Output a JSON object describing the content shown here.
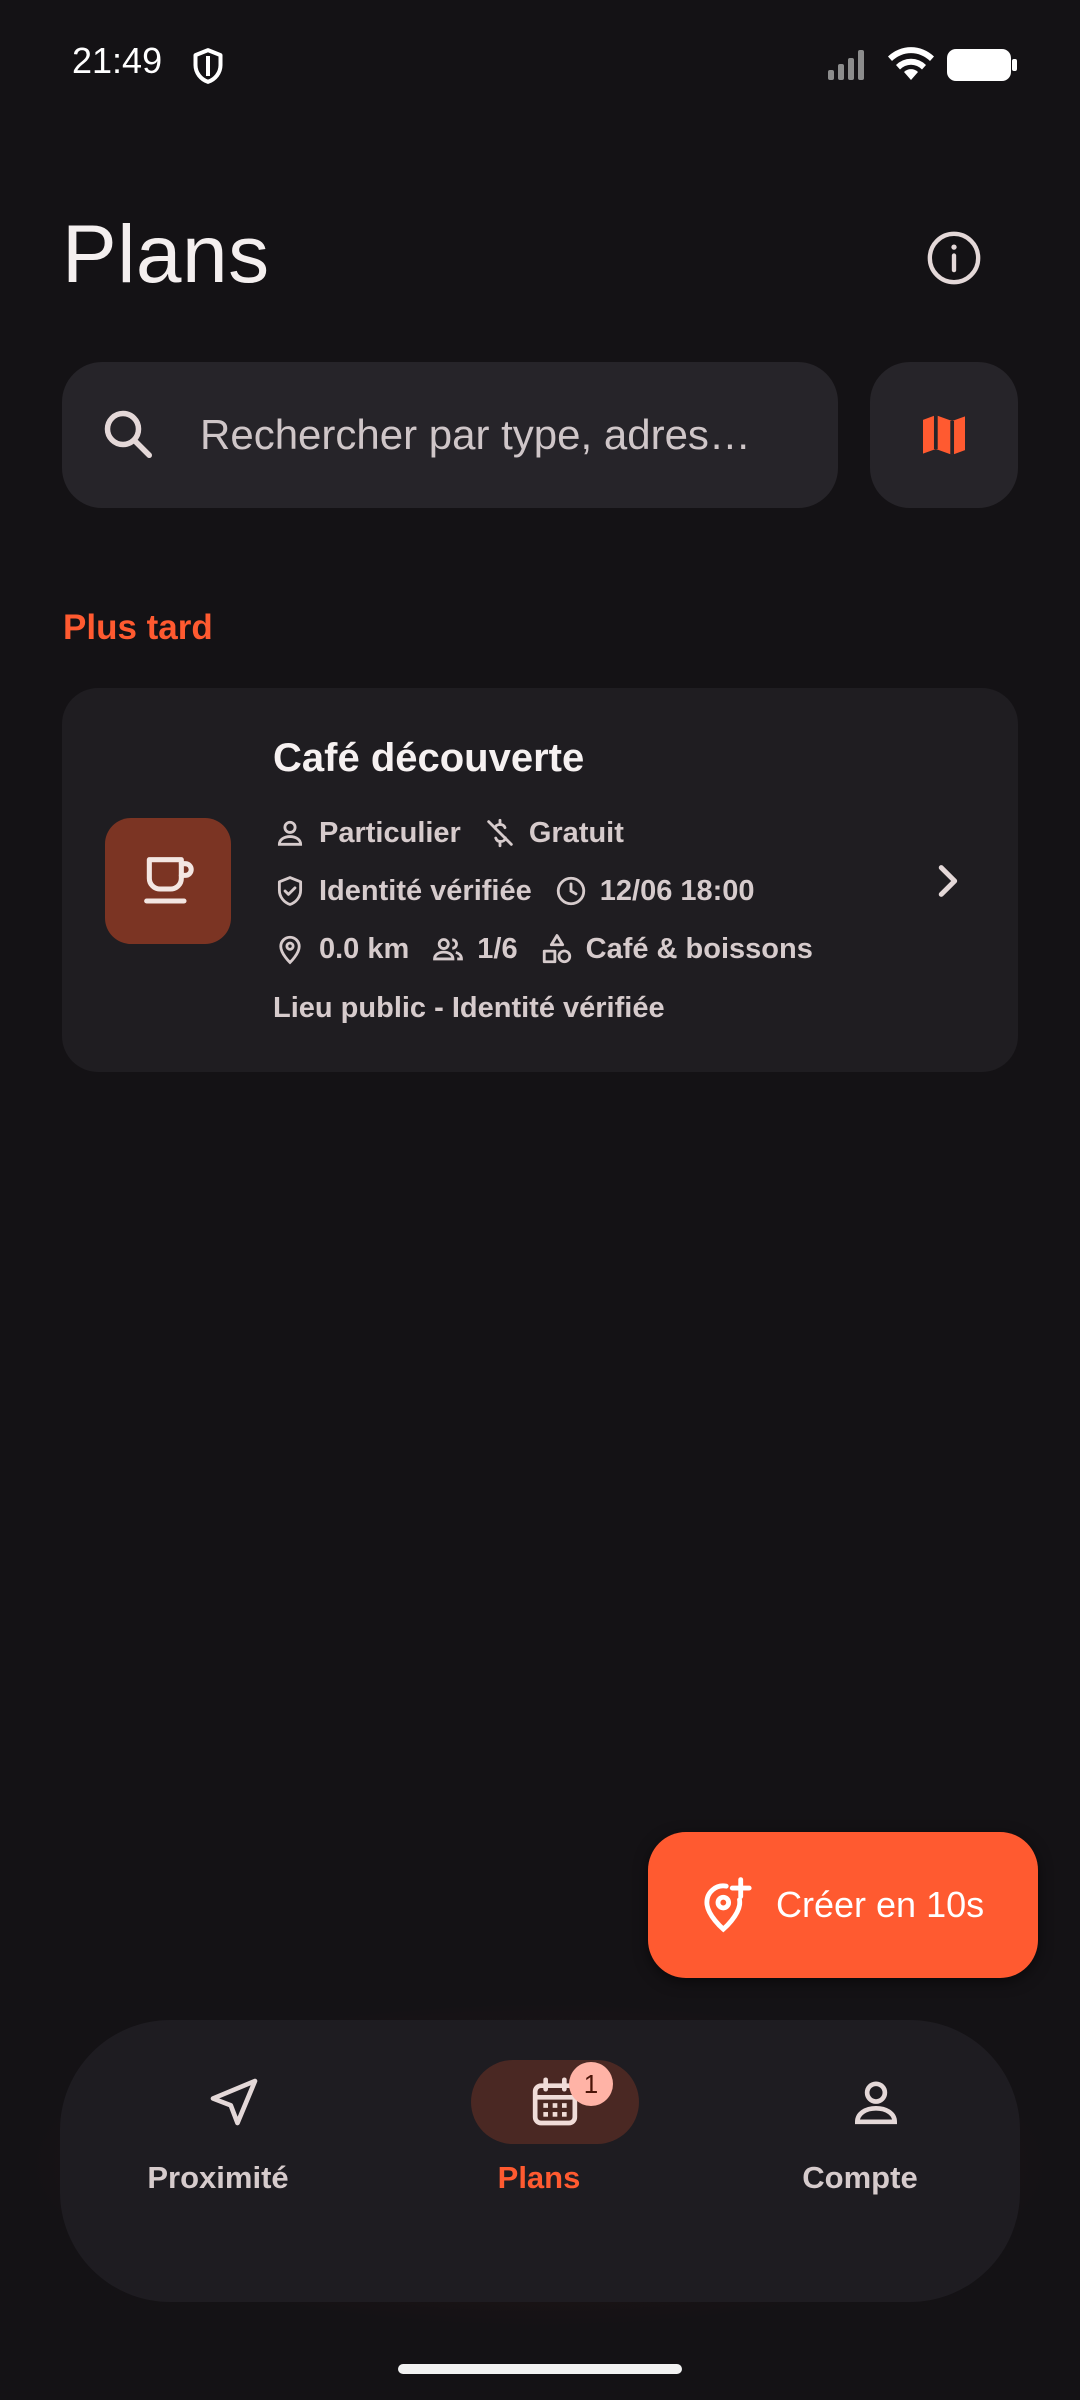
{
  "status_bar": {
    "time": "21:49"
  },
  "header": {
    "title": "Plans"
  },
  "search": {
    "placeholder": "Rechercher par type, adres…"
  },
  "section": {
    "label": "Plus tard"
  },
  "plan": {
    "title": "Café découverte",
    "host_type": "Particulier",
    "price": "Gratuit",
    "verification": "Identité vérifiée",
    "datetime": "12/06 18:00",
    "distance": "0.0 km",
    "participants": "1/6",
    "category": "Café & boissons",
    "description": "Lieu public - Identité vérifiée"
  },
  "fab": {
    "label": "Créer en 10s"
  },
  "nav": {
    "items": [
      {
        "label": "Proximité",
        "icon": "navigation-arrow-icon"
      },
      {
        "label": "Plans",
        "icon": "calendar-icon",
        "badge": "1"
      },
      {
        "label": "Compte",
        "icon": "person-icon"
      }
    ],
    "active": "Plans"
  },
  "colors": {
    "accent": "#ff5a30",
    "background": "#141215",
    "surface": "#1f1d21"
  }
}
